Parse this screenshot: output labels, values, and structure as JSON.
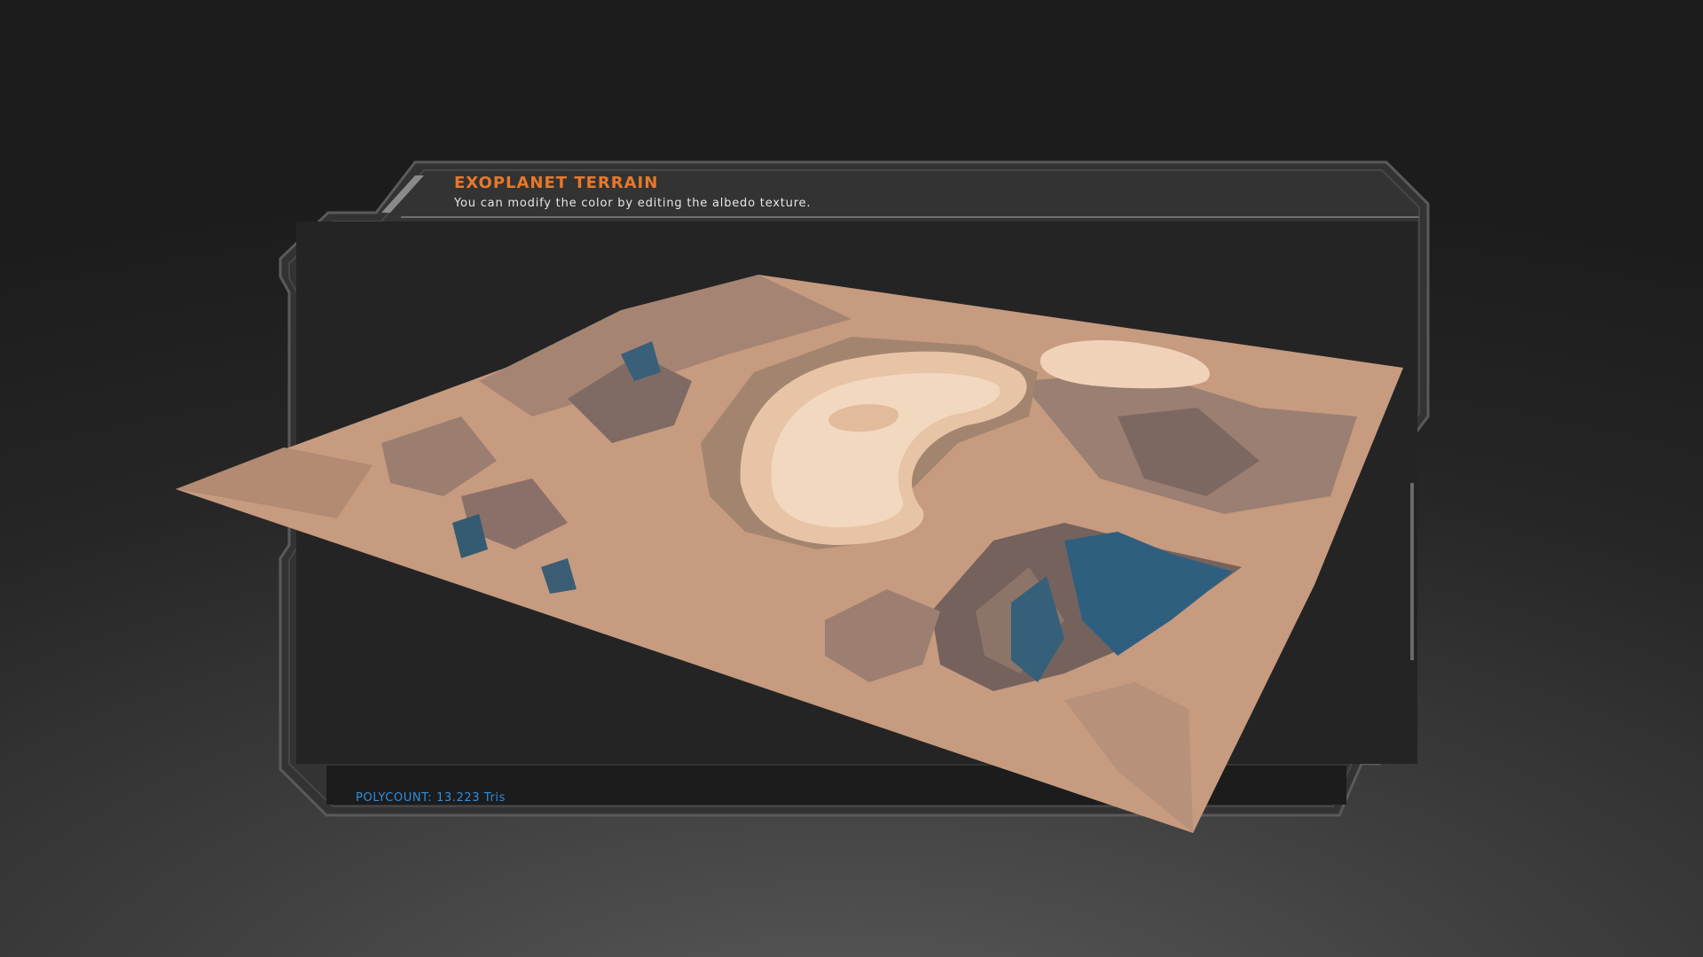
{
  "panel": {
    "title": "EXOPLANET TERRAIN",
    "subtitle": "You can modify the color by editing the albedo texture.",
    "footer_label": "POLYCOUNT: 13.223 Tris"
  },
  "colors": {
    "title": "#e8782a",
    "subtitle": "#e6e6e6",
    "footer": "#2e8fe0",
    "frame": "#3a3a3a",
    "frame_edge": "#5a5a5a",
    "panel_bg": "#242424",
    "sand": "#c79b7e",
    "sand_light": "#e9c6aa",
    "sand_highlight": "#f6dcc4",
    "rock_shadow": "#7d6a62",
    "rock_blue": "#2d5f80"
  },
  "icons": {
    "hud_frame": "sci-fi-frame-icon"
  }
}
